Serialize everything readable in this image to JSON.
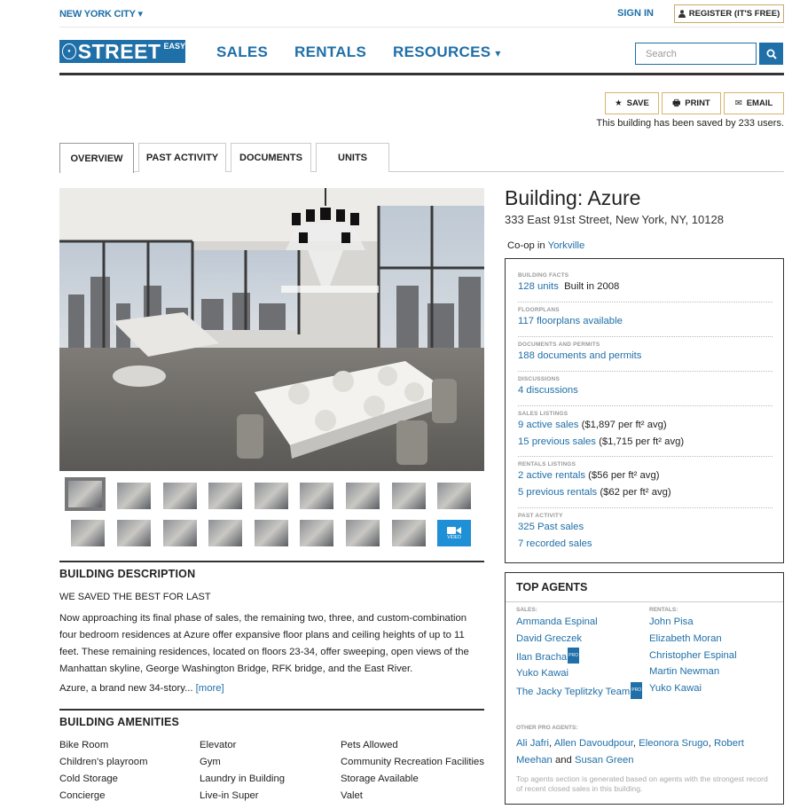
{
  "topbar": {
    "city": "NEW YORK CITY",
    "sign_in": "SIGN IN",
    "register": "REGISTER (IT'S FREE)"
  },
  "header": {
    "logo_text": "STREET",
    "logo_easy": "EASY",
    "nav": [
      "SALES",
      "RENTALS",
      "RESOURCES"
    ],
    "search_placeholder": "Search"
  },
  "actions": {
    "save": "SAVE",
    "print": "PRINT",
    "email": "EMAIL",
    "saved_note": "This building has been saved by 233 users."
  },
  "tabs": [
    "OVERVIEW",
    "PAST ACTIVITY",
    "DOCUMENTS",
    "UNITS"
  ],
  "thumbnails": {
    "video_label": "VIDEO"
  },
  "building": {
    "name": "Building: Azure",
    "address": "333 East 91st Street, New York, NY, 10128",
    "type_prefix": "Co-op in ",
    "neighborhood": "Yorkville"
  },
  "facts": {
    "building_facts_label": "BUILDING FACTS",
    "units_link": "128 units",
    "built": "Built in 2008",
    "floorplans_label": "FLOORPLANS",
    "floorplans_link": "117 floorplans available",
    "documents_label": "DOCUMENTS AND PERMITS",
    "documents_link": "188 documents and permits",
    "discussions_label": "DISCUSSIONS",
    "discussions_link": "4 discussions",
    "sales_label": "SALES LISTINGS",
    "active_sales_link": "9 active sales",
    "active_sales_avg": "($1,897 per ft² avg)",
    "previous_sales_link": "15 previous sales",
    "previous_sales_avg": "($1,715 per ft² avg)",
    "rentals_label": "RENTALS LISTINGS",
    "active_rentals_link": "2 active rentals",
    "active_rentals_avg": "($56 per ft² avg)",
    "previous_rentals_link": "5 previous rentals",
    "previous_rentals_avg": "($62 per ft² avg)",
    "past_label": "PAST ACTIVITY",
    "past_sales_link": "325 Past sales",
    "recorded_sales_link": "7 recorded sales"
  },
  "description": {
    "title": "BUILDING DESCRIPTION",
    "subtitle": "WE SAVED THE BEST FOR LAST",
    "body": "Now approaching its final phase of sales, the remaining two, three, and custom-combination four bedroom residences at Azure offer expansive floor plans and ceiling heights of up to 11 feet. These remaining residences, located on floors 23-34, offer sweeping, open views of the Manhattan skyline, George Washington Bridge, RFK bridge, and the East River.",
    "teaser": "Azure, a brand new 34-story... ",
    "more": "[more]"
  },
  "amenities": {
    "title": "BUILDING AMENITIES",
    "col1": [
      "Bike Room",
      "Children's playroom",
      "Cold Storage",
      "Concierge"
    ],
    "col2": [
      "Elevator",
      "Gym",
      "Laundry in Building",
      "Live-in Super"
    ],
    "col3": [
      "Pets Allowed",
      "Community Recreation Facilities",
      "Storage Available",
      "Valet"
    ]
  },
  "agents": {
    "title": "TOP AGENTS",
    "sales_label": "SALES:",
    "rentals_label": "RENTALS:",
    "sales": [
      "Ammanda Espinal",
      "David Greczek",
      "Ilan Bracha",
      "Yuko Kawai",
      "The Jacky Teplitzky Team"
    ],
    "rentals": [
      "John Pisa",
      "Elizabeth Moran",
      "Christopher Espinal",
      "Martin Newman",
      "Yuko Kawai"
    ],
    "pro_badge": "PRO",
    "other_label": "OTHER PRO AGENTS:",
    "other": [
      "Ali Jafri",
      "Allen Davoudpour",
      "Eleonora Srugo",
      "Robert Meehan",
      "Susan Green"
    ],
    "and": "and",
    "footnote": "Top agents section is generated based on agents with the strongest record of recent closed sales in this building."
  }
}
